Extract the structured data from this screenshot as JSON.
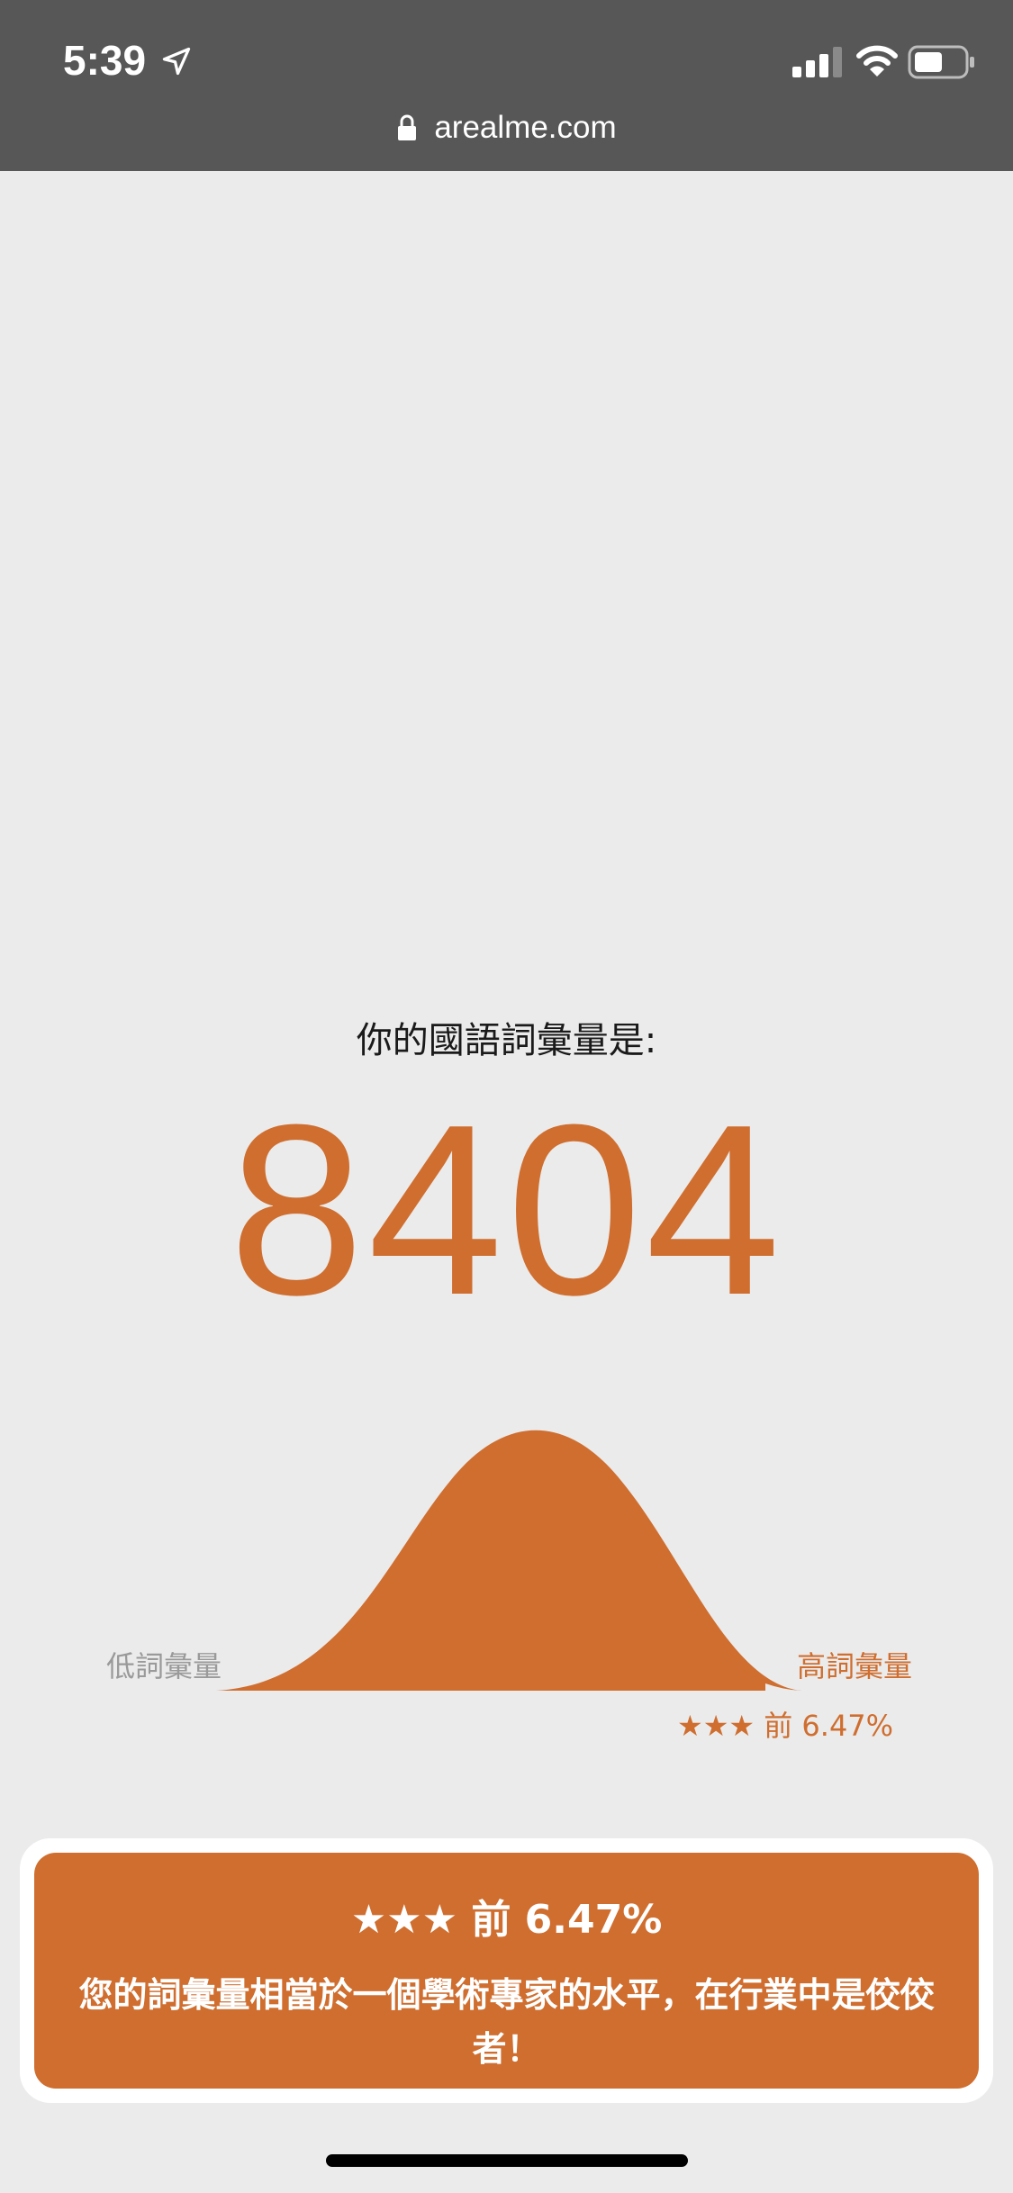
{
  "status_bar": {
    "time": "5:39",
    "url": "arealme.com",
    "icons": [
      "location-arrow-icon",
      "signal-icon",
      "wifi-icon",
      "battery-icon",
      "lock-icon"
    ]
  },
  "result": {
    "heading": "你的國語詞彙量是:",
    "score": "8404",
    "low_label": "低詞彙量",
    "high_label": "高詞彙量",
    "rank_small": "★★★ 前 6.47%"
  },
  "card": {
    "rank": "★★★ 前 6.47%",
    "description": "您的詞彙量相當於一個學術專家的水平，在行業中是佼佼者！"
  },
  "colors": {
    "accent": "#cf6e2f",
    "status_bar_bg": "#575757",
    "page_bg": "#ebebeb"
  }
}
